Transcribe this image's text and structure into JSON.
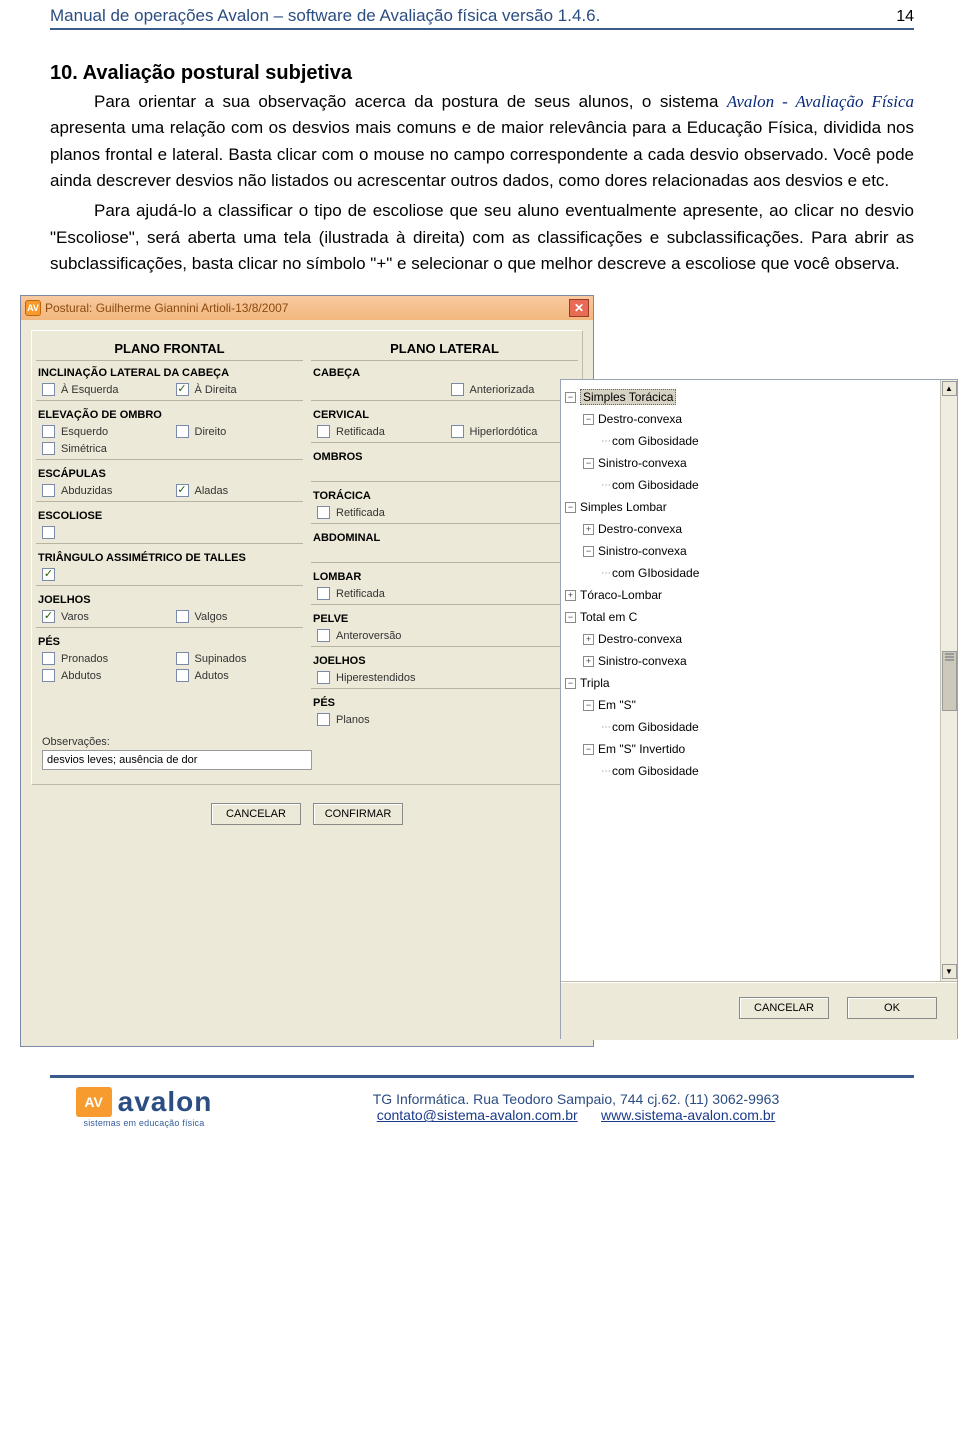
{
  "header": {
    "doc_title": "Manual de operações Avalon – software de Avaliação física versão 1.4.6.",
    "page_number": "14"
  },
  "section": {
    "title": "10. Avaliação postural subjetiva",
    "p1a": "Para orientar a sua observação acerca da postura de seus alunos, o sistema ",
    "p1_em": "Avalon - Avaliação Física",
    "p1b": " apresenta uma relação com os desvios mais comuns e de maior relevância para a Educação Física, dividida nos planos frontal e lateral. Basta clicar com o mouse no campo correspondente a cada desvio observado. Você pode ainda descrever desvios não listados ou acrescentar outros dados, como dores relacionadas aos desvios e etc.",
    "p2": "Para ajudá-lo a classificar o tipo de escoliose que seu aluno eventualmente apresente, ao clicar no desvio \"Escoliose\", será aberta uma tela (ilustrada à direita) com as classificações e subclassificações. Para abrir as subclassificações, basta clicar no símbolo \"+\" e selecionar o que melhor descreve a escoliose que você observa."
  },
  "winMain": {
    "icon_text": "AV",
    "title": "Postural: Guilherme Giannini Artioli-13/8/2007",
    "col_frontal": "PLANO FRONTAL",
    "col_lateral": "PLANO LATERAL",
    "frontal": {
      "g1": "INCLINAÇÃO LATERAL DA CABEÇA",
      "g1a": "À Esquerda",
      "g1b": "À Direita",
      "g2": "ELEVAÇÃO DE OMBRO",
      "g2a": "Esquerdo",
      "g2b": "Direito",
      "g2c": "Simétrica",
      "g3": "ESCÁPULAS",
      "g3a": "Abduzidas",
      "g3b": "Aladas",
      "g4": "ESCOLIOSE",
      "g5": "TRIÂNGULO ASSIMÉTRICO DE TALLES",
      "g6": "JOELHOS",
      "g6a": "Varos",
      "g6b": "Valgos",
      "g7": "PÉS",
      "g7a": "Pronados",
      "g7b": "Supinados",
      "g7c": "Abdutos",
      "g7d": "Adutos"
    },
    "lateral": {
      "l1": "CABEÇA",
      "l1a": "Anteriorizada",
      "l2": "CERVICAL",
      "l2a": "Retificada",
      "l2b": "Hiperlordótica",
      "l3": "OMBROS",
      "l4": "TORÁCICA",
      "l4a": "Retificada",
      "l5": "ABDOMINAL",
      "l6": "LOMBAR",
      "l6a": "Retificada",
      "l7": "PELVE",
      "l7a": "Anteroversão",
      "l8": "JOELHOS",
      "l8a": "Hiperestendidos",
      "l9": "PÉS",
      "l9a": "Planos"
    },
    "obs_label": "Observações:",
    "obs_value": "desvios leves; ausência de dor",
    "btn_cancel": "CANCELAR",
    "btn_confirm": "CONFIRMAR"
  },
  "tree": {
    "n1": "Simples Torácica",
    "n1a": "Destro-convexa",
    "n1a1": "com Gibosidade",
    "n1b": "Sinistro-convexa",
    "n1b1": "com Gibosidade",
    "n2": "Simples Lombar",
    "n2a": "Destro-convexa",
    "n2b": "Sinistro-convexa",
    "n2b1": "com GIbosidade",
    "n3": "Tóraco-Lombar",
    "n4": "Total em C",
    "n4a": "Destro-convexa",
    "n4b": "Sinistro-convexa",
    "n5": "Tripla",
    "n5a": "Em \"S\"",
    "n5a1": "com Gibosidade",
    "n5b": "Em \"S\" Invertido",
    "n5b1": "com Gibosidade",
    "btn_cancel": "CANCELAR",
    "btn_ok": "OK",
    "scroll_up": "▲",
    "scroll_down": "▼"
  },
  "footer": {
    "logo_mark": "AV",
    "logo_word": "avalon",
    "logo_sub": "sistemas em educação física",
    "line1": "TG Informática. Rua Teodoro Sampaio, 744 cj.62. (11) 3062-9963",
    "mail": "contato@sistema-avalon.com.br",
    "site": "www.sistema-avalon.com.br"
  }
}
